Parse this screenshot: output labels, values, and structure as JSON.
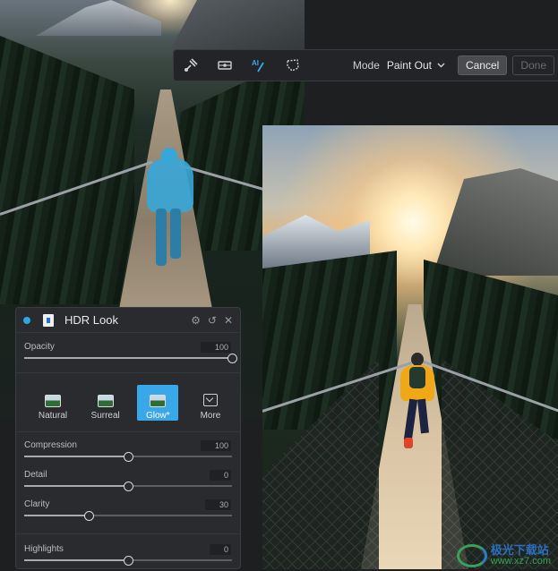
{
  "toolbar": {
    "tools": [
      "brush-icon",
      "gradient-icon",
      "ai-mask-icon",
      "mask-select-icon"
    ],
    "ai_label": "AI",
    "mode_label": "Mode",
    "mode_value": "Paint Out",
    "cancel_label": "Cancel",
    "done_label": "Done"
  },
  "panel": {
    "title": "HDR Look",
    "opacity": {
      "label": "Opacity",
      "value": "100",
      "fraction": 1.0
    },
    "presets": [
      {
        "label": "Natural",
        "selected": false
      },
      {
        "label": "Surreal",
        "selected": false
      },
      {
        "label": "Glow*",
        "selected": true
      },
      {
        "label": "More",
        "selected": false
      }
    ],
    "sliders": [
      {
        "label": "Compression",
        "value": "100",
        "fraction": 0.5
      },
      {
        "label": "Detail",
        "value": "0",
        "fraction": 0.5
      },
      {
        "label": "Clarity",
        "value": "30",
        "fraction": 0.31
      },
      {
        "label": "Highlights",
        "value": "0",
        "fraction": 0.5
      }
    ]
  },
  "watermark": {
    "line1": "极光下载站",
    "line2": "www.xz7.com"
  },
  "colors": {
    "accent": "#3aa8e8",
    "mask": "#37a6d8",
    "panel_bg": "#2a2b2e"
  }
}
